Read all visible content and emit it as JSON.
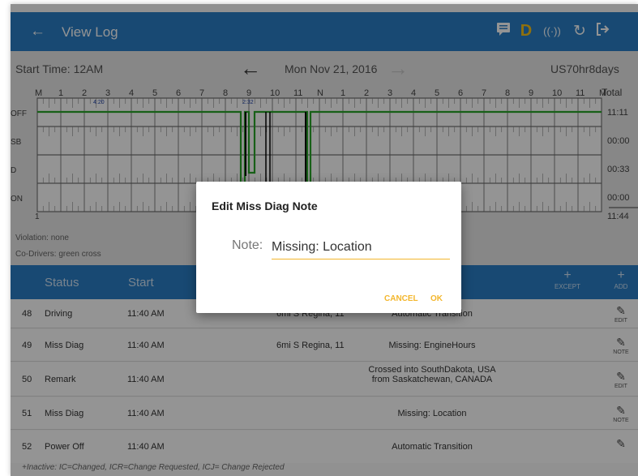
{
  "appbar": {
    "back_icon": "←",
    "title": "View Log",
    "actions": [
      {
        "name": "message-icon",
        "glyph": "▤"
      },
      {
        "name": "duty-status-icon",
        "glyph": "D"
      },
      {
        "name": "wireless-icon",
        "glyph": "((·))"
      },
      {
        "name": "refresh-icon",
        "glyph": "↻"
      },
      {
        "name": "logout-icon",
        "glyph": "⎋"
      }
    ]
  },
  "log": {
    "start_time": "Start Time: 12AM",
    "prev_icon": "←",
    "date": "Mon Nov 21, 2016",
    "next_icon": "→",
    "cycle": "US70hr8days",
    "hour_labels": [
      "M",
      "1",
      "2",
      "3",
      "4",
      "5",
      "6",
      "7",
      "8",
      "9",
      "10",
      "11",
      "N",
      "1",
      "2",
      "3",
      "4",
      "5",
      "6",
      "7",
      "8",
      "9",
      "10",
      "11",
      "M"
    ],
    "row_labels": [
      "OFF",
      "SB",
      "D",
      "ON"
    ],
    "total_header": "Total",
    "totals": [
      "11:11",
      "00:00",
      "00:33",
      "00:00"
    ],
    "grand_total": "11:44",
    "bottom_label": "1",
    "marker1": "4:20",
    "marker2": "2:32",
    "violation": "Violation: none",
    "codrivers": "Co-Drivers: green cross"
  },
  "table": {
    "headers": {
      "status": "Status",
      "start": "Start",
      "except": "EXCEPT",
      "add": "ADD",
      "plus": "+"
    },
    "rows": [
      {
        "no": "48",
        "status": "Driving",
        "start": "11:40 AM",
        "loc": "6mi S Regina, 11",
        "note": "Automatic Transition",
        "action": "EDIT"
      },
      {
        "no": "49",
        "status": "Miss Diag",
        "start": "11:40 AM",
        "loc": "6mi S Regina, 11",
        "note": "Missing: EngineHours",
        "action": "NOTE"
      },
      {
        "no": "50",
        "status": "Remark",
        "start": "11:40 AM",
        "loc": "",
        "note": "Crossed into SouthDakota, USA from Saskatchewan, CANADA",
        "action": "EDIT"
      },
      {
        "no": "51",
        "status": "Miss Diag",
        "start": "11:40 AM",
        "loc": "",
        "note": "Missing: Location",
        "action": "NOTE"
      },
      {
        "no": "52",
        "status": "Power Off",
        "start": "11:40 AM",
        "loc": "",
        "note": "Automatic Transition",
        "action": ""
      }
    ],
    "footnote": "+Inactive: IC=Changed, ICR=Change Requested, ICJ= Change Rejected"
  },
  "dialog": {
    "title": "Edit Miss Diag Note",
    "note_label": "Note:",
    "note_value": "Missing: Location",
    "cancel": "CANCEL",
    "ok": "OK"
  },
  "colors": {
    "primary": "#2a7fc6",
    "accent": "#f3b62c",
    "line_green": "#2aa52a"
  }
}
